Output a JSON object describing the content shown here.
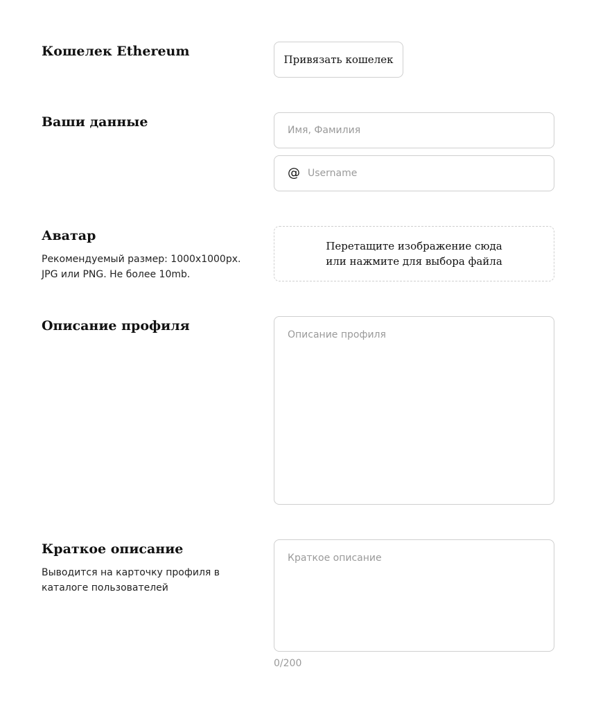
{
  "wallet": {
    "title": "Кошелек Ethereum",
    "connect_button_label": "Привязать кошелек"
  },
  "personal": {
    "title": "Ваши данные",
    "name_placeholder": "Имя, Фамилия",
    "username_icon": "@",
    "username_placeholder": "Username"
  },
  "avatar": {
    "title": "Аватар",
    "hint_line1": "Рекомендуемый размер: 1000x1000px.",
    "hint_line2": "JPG или PNG. Не более 10mb.",
    "dropzone_line1": "Перетащите изображение сюда",
    "dropzone_line2": "или нажмите для выбора файла"
  },
  "profile_description": {
    "title": "Описание профиля",
    "placeholder": "Описание профиля"
  },
  "short_description": {
    "title": "Краткое описание",
    "hint": "Выводится на карточку профиля в каталоге пользователей",
    "placeholder": "Краткое описание",
    "counter": "0/200"
  }
}
